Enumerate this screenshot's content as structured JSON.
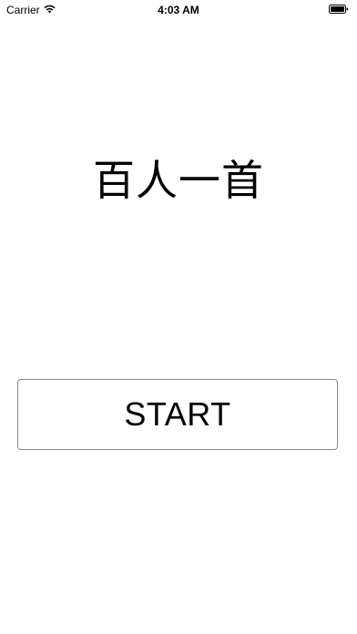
{
  "status_bar": {
    "carrier": "Carrier",
    "time": "4:03 AM",
    "icons": [
      "wifi-icon",
      "battery-icon"
    ]
  },
  "main": {
    "title": "百人一首",
    "start_label": "START"
  },
  "colors": {
    "background": "#ffffff",
    "text": "#000000",
    "button_border": "#8a8a8a"
  }
}
